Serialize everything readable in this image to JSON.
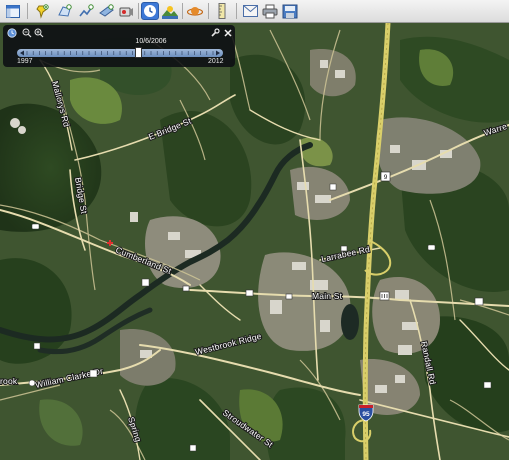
{
  "toolbar": {
    "buttons": [
      {
        "icon": "sidebar-toggle-icon"
      },
      {
        "icon": "add-placemark-icon"
      },
      {
        "icon": "add-polygon-icon"
      },
      {
        "icon": "add-path-icon"
      },
      {
        "icon": "add-image-overlay-icon"
      },
      {
        "icon": "record-tour-icon"
      },
      {
        "icon": "historical-imagery-icon",
        "active": true
      },
      {
        "icon": "sunlight-icon"
      },
      {
        "icon": "planets-icon"
      },
      {
        "icon": "ruler-icon"
      },
      {
        "icon": "email-icon"
      },
      {
        "icon": "print-icon"
      },
      {
        "icon": "save-image-icon"
      }
    ]
  },
  "time_slider": {
    "current_date": "10/6/2006",
    "start_year": "1997",
    "end_year": "2012",
    "position": 0.6
  },
  "map": {
    "road_labels": {
      "mallorys": "Mallorys Rd",
      "e_bridge": "E Bridge St",
      "bridge": "Bridge St",
      "cumberland": "Cumberland St",
      "larrabee": "Larrabee Rd",
      "main": "Main St",
      "warren": "Warre",
      "randall": "Randall Rd",
      "westbrook_ridge": "Westbrook Ridge",
      "stroudwater": "Stroudwater St",
      "william_clarke": "William Clarke Dr",
      "brook": "rook",
      "spring": "Spring"
    },
    "highway_shield": "95",
    "route_shield": "9"
  },
  "colors": {
    "toolbar_active": "#3d78d6",
    "highway": "#d9cf6a",
    "road": "#e6dcae",
    "panel_bg": "#0c0e12"
  }
}
